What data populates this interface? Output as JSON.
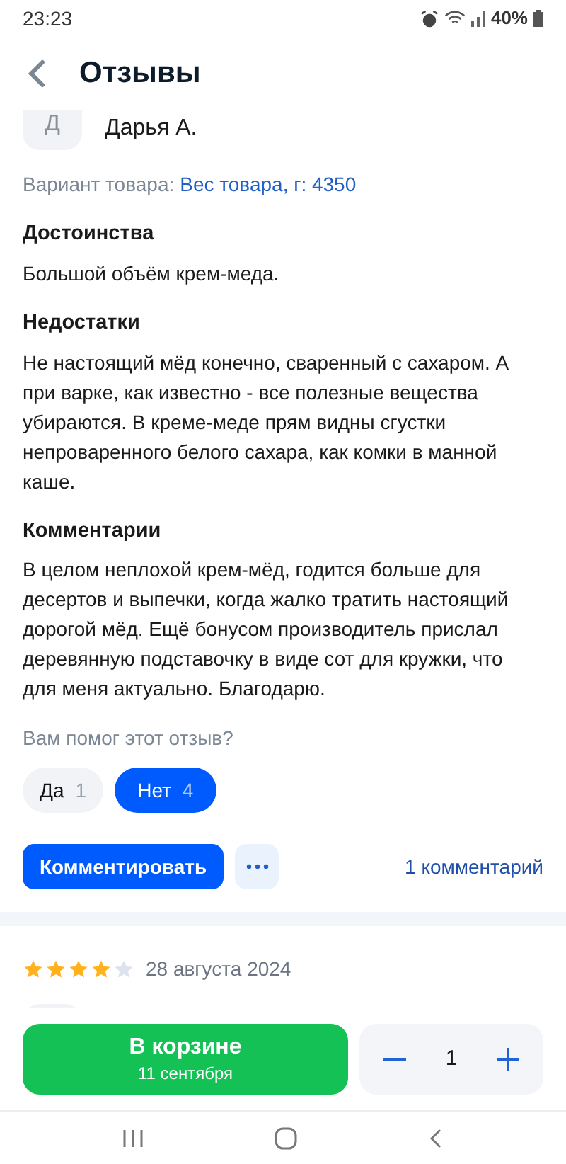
{
  "status_bar": {
    "time": "23:23",
    "battery": "40%"
  },
  "header": {
    "title": "Отзывы"
  },
  "review": {
    "avatar_letter": "Д",
    "author": "Дарья А.",
    "variant_label": "Вариант товара:",
    "variant_value": "Вес товара, г: 4350",
    "sections": [
      {
        "heading": "Достоинства",
        "text": "Большой объём крем-меда."
      },
      {
        "heading": "Недостатки",
        "text": "Не настоящий мёд конечно, сваренный с сахаром. А при варке, как известно - все полезные вещества убираются. В креме-меде прям видны сгустки непроваренного белого сахара, как комки в манной каше."
      },
      {
        "heading": "Комментарии",
        "text": "В целом неплохой крем-мёд, годится больше для десертов и выпечки, когда жалко тратить настоящий дорогой мёд. Ещё бонусом производитель прислал деревянную подставочку в виде сот для кружки, что для меня актуально. Благодарю."
      }
    ],
    "helpful_question": "Вам помог этот отзыв?",
    "votes": [
      {
        "label": "Да",
        "count": "1",
        "selected": false
      },
      {
        "label": "Нет",
        "count": "4",
        "selected": true
      }
    ],
    "comment_button": "Комментировать",
    "comments_link": "1 комментарий"
  },
  "next_review": {
    "stars": 4,
    "date": "28 августа 2024"
  },
  "cart": {
    "button_label": "В корзине",
    "delivery": "11 сентября",
    "quantity": "1"
  }
}
